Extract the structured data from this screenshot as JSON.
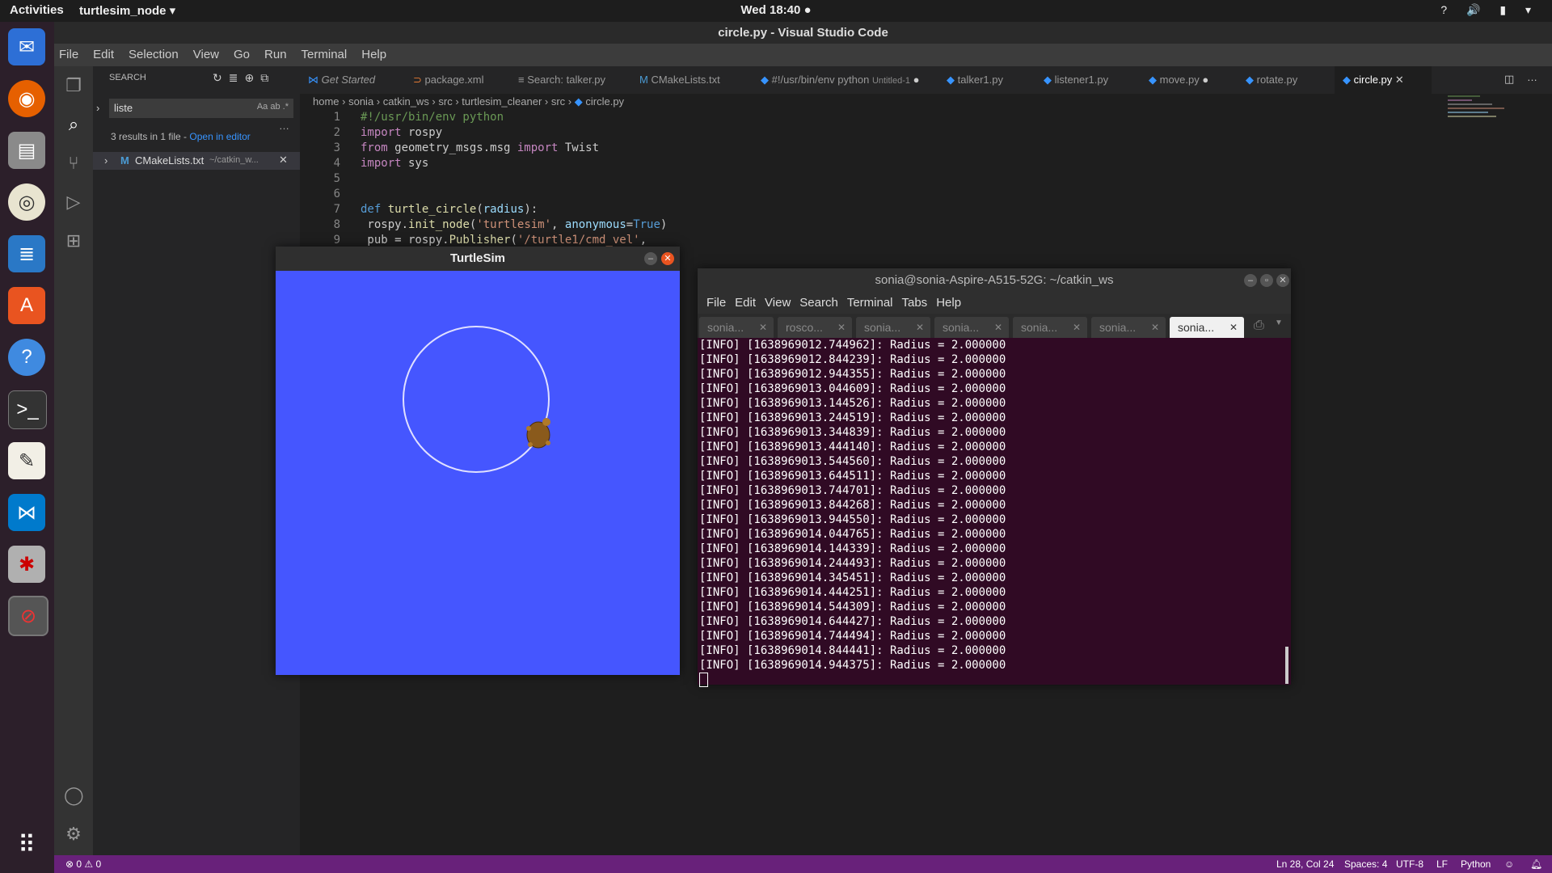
{
  "topbar": {
    "activities": "Activities",
    "app_menu": "turtlesim_node ▾",
    "clock": "Wed 18:40 ●",
    "tray": "? 🔊 ▮ ▾"
  },
  "dock": {
    "icons": [
      "thunderbird-icon",
      "firefox-icon",
      "files-icon",
      "rhythmbox-icon",
      "writer-icon",
      "software-icon",
      "help-icon",
      "terminal-icon",
      "text-editor-icon",
      "vscode-icon",
      "settings-icon",
      "stop-icon",
      "apps-grid-icon"
    ]
  },
  "vscode": {
    "title": "circle.py - Visual Studio Code",
    "menu": [
      "File",
      "Edit",
      "Selection",
      "View",
      "Go",
      "Run",
      "Terminal",
      "Help"
    ],
    "search": {
      "header": "SEARCH",
      "query": "liste",
      "results_text": "3 results in 1 file -",
      "open_in_editor": "Open in editor",
      "result_file": "CMakeLists.txt",
      "result_path": "~/catkin_w...",
      "opt_case": "Aa",
      "opt_word": "ab",
      "opt_regex": ".*"
    },
    "tabs": [
      {
        "label": "Get Started",
        "icon": "vscode-icon"
      },
      {
        "label": "package.xml",
        "icon": "rss-icon"
      },
      {
        "label": "Search: talker.py",
        "icon": "list-icon"
      },
      {
        "label": "CMakeLists.txt",
        "icon": "m-icon"
      },
      {
        "label": "#!/usr/bin/env python",
        "sub": "Untitled-1",
        "icon": "python-icon"
      },
      {
        "label": "talker1.py",
        "icon": "python-icon"
      },
      {
        "label": "listener1.py",
        "icon": "python-icon"
      },
      {
        "label": "move.py",
        "icon": "python-icon"
      },
      {
        "label": "rotate.py",
        "icon": "python-icon"
      },
      {
        "label": "circle.py",
        "icon": "python-icon"
      }
    ],
    "breadcrumb": [
      "home",
      "sonia",
      "catkin_ws",
      "src",
      "turtlesim_cleaner",
      "src",
      "circle.py"
    ],
    "code_lines": [
      "1",
      "2",
      "3",
      "4",
      "5",
      "6",
      "7",
      "8",
      "9"
    ],
    "status": {
      "problems": "⊗ 0 ⚠ 0",
      "position": "Ln 28, Col 24",
      "spaces": "Spaces: 4",
      "encoding": "UTF-8",
      "eol": "LF",
      "language": "Python"
    }
  },
  "turtlesim": {
    "title": "TurtleSim"
  },
  "terminal": {
    "title": "sonia@sonia-Aspire-A515-52G: ~/catkin_ws",
    "menu": [
      "File",
      "Edit",
      "View",
      "Search",
      "Terminal",
      "Tabs",
      "Help"
    ],
    "tabs": [
      "sonia...",
      "rosco...",
      "sonia...",
      "sonia...",
      "sonia...",
      "sonia...",
      "sonia..."
    ],
    "lines": [
      "[INFO] [1638969012.744962]: Radius = 2.000000",
      "[INFO] [1638969012.844239]: Radius = 2.000000",
      "[INFO] [1638969012.944355]: Radius = 2.000000",
      "[INFO] [1638969013.044609]: Radius = 2.000000",
      "[INFO] [1638969013.144526]: Radius = 2.000000",
      "[INFO] [1638969013.244519]: Radius = 2.000000",
      "[INFO] [1638969013.344839]: Radius = 2.000000",
      "[INFO] [1638969013.444140]: Radius = 2.000000",
      "[INFO] [1638969013.544560]: Radius = 2.000000",
      "[INFO] [1638969013.644511]: Radius = 2.000000",
      "[INFO] [1638969013.744701]: Radius = 2.000000",
      "[INFO] [1638969013.844268]: Radius = 2.000000",
      "[INFO] [1638969013.944550]: Radius = 2.000000",
      "[INFO] [1638969014.044765]: Radius = 2.000000",
      "[INFO] [1638969014.144339]: Radius = 2.000000",
      "[INFO] [1638969014.244493]: Radius = 2.000000",
      "[INFO] [1638969014.345451]: Radius = 2.000000",
      "[INFO] [1638969014.444251]: Radius = 2.000000",
      "[INFO] [1638969014.544309]: Radius = 2.000000",
      "[INFO] [1638969014.644427]: Radius = 2.000000",
      "[INFO] [1638969014.744494]: Radius = 2.000000",
      "[INFO] [1638969014.844441]: Radius = 2.000000",
      "[INFO] [1638969014.944375]: Radius = 2.000000"
    ]
  },
  "colors": {
    "status_bar": "#68217a",
    "turtle_bg": "#4556ff",
    "terminal_bg": "#300a24"
  }
}
